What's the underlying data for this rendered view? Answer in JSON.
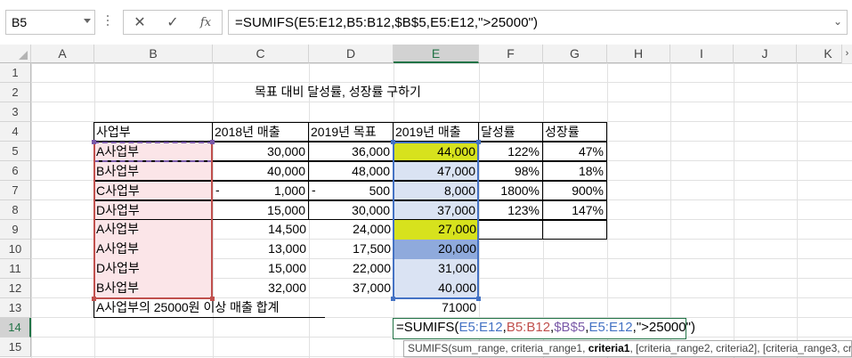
{
  "name_box": {
    "value": "B5"
  },
  "formula_bar": {
    "cancel_glyph": "✕",
    "enter_glyph": "✓",
    "insert_function_label": "fx",
    "formula": "=SUMIFS(E5:E12,B5:B12,$B$5,E5:E12,\">25000\")",
    "expand_glyph": "⌄"
  },
  "columns": [
    "A",
    "B",
    "C",
    "D",
    "E",
    "F",
    "G",
    "H",
    "I",
    "J",
    "K"
  ],
  "rows": [
    "1",
    "2",
    "3",
    "4",
    "5",
    "6",
    "7",
    "8",
    "9",
    "10",
    "11",
    "12",
    "13",
    "14",
    "15"
  ],
  "selected_column": "E",
  "selected_row": "14",
  "sheet": {
    "title": "목표 대비 달성률, 성장률 구하기",
    "headers": [
      "사업부",
      "2018년 매출",
      "2019년 목표",
      "2019년 매출",
      "달성률",
      "성장률"
    ],
    "table_rows": [
      {
        "division": "A사업부",
        "sales_2018": "30,000",
        "target_2019": "36,000",
        "sales_2019": "44,000",
        "achievement": "122%",
        "growth": "47%",
        "neg18": "",
        "neg19": ""
      },
      {
        "division": "B사업부",
        "sales_2018": "40,000",
        "target_2019": "48,000",
        "sales_2019": "47,000",
        "achievement": "98%",
        "growth": "18%",
        "neg18": "",
        "neg19": ""
      },
      {
        "division": "C사업부",
        "sales_2018": "1,000",
        "target_2019": "500",
        "sales_2019": "8,000",
        "achievement": "1800%",
        "growth": "900%",
        "neg18": "-",
        "neg19": "-"
      },
      {
        "division": "D사업부",
        "sales_2018": "15,000",
        "target_2019": "30,000",
        "sales_2019": "37,000",
        "achievement": "123%",
        "growth": "147%",
        "neg18": "",
        "neg19": ""
      },
      {
        "division": "A사업부",
        "sales_2018": "14,500",
        "target_2019": "24,000",
        "sales_2019": "27,000",
        "achievement": "",
        "growth": "",
        "neg18": "",
        "neg19": ""
      },
      {
        "division": "A사업부",
        "sales_2018": "13,000",
        "target_2019": "17,500",
        "sales_2019": "20,000",
        "achievement": "",
        "growth": "",
        "neg18": "",
        "neg19": ""
      },
      {
        "division": "D사업부",
        "sales_2018": "15,000",
        "target_2019": "22,000",
        "sales_2019": "31,000",
        "achievement": "",
        "growth": "",
        "neg18": "",
        "neg19": ""
      },
      {
        "division": "B사업부",
        "sales_2018": "32,000",
        "target_2019": "37,000",
        "sales_2019": "40,000",
        "achievement": "",
        "growth": "",
        "neg18": "",
        "neg19": ""
      }
    ],
    "summary_label": "A사업부의 25000원 이상 매출 합계",
    "summary_value": "71000",
    "edit_formula_parts": {
      "prefix": "=SUMIFS(",
      "range1": "E5:E12",
      "sep1": ",",
      "range2": "B5:B12",
      "sep2": ",",
      "range3": "$B$5",
      "sep3": ",",
      "range4": "E5:E12",
      "suffix": ",\">25000\")"
    },
    "tooltip": {
      "fn": "SUMIFS(",
      "args_before": "sum_range, criteria_range1, ",
      "current_arg": "criteria1",
      "args_after": ", [criteria_range2, criteria2], [criteria_range3, crit"
    }
  },
  "colors": {
    "accent_green": "#217346",
    "ref_blue": "#4472c4",
    "ref_red": "#c0504d",
    "ref_purple": "#7a5aa8",
    "highlight_lime": "#d7e21d",
    "highlight_blue": "#8faadc"
  }
}
